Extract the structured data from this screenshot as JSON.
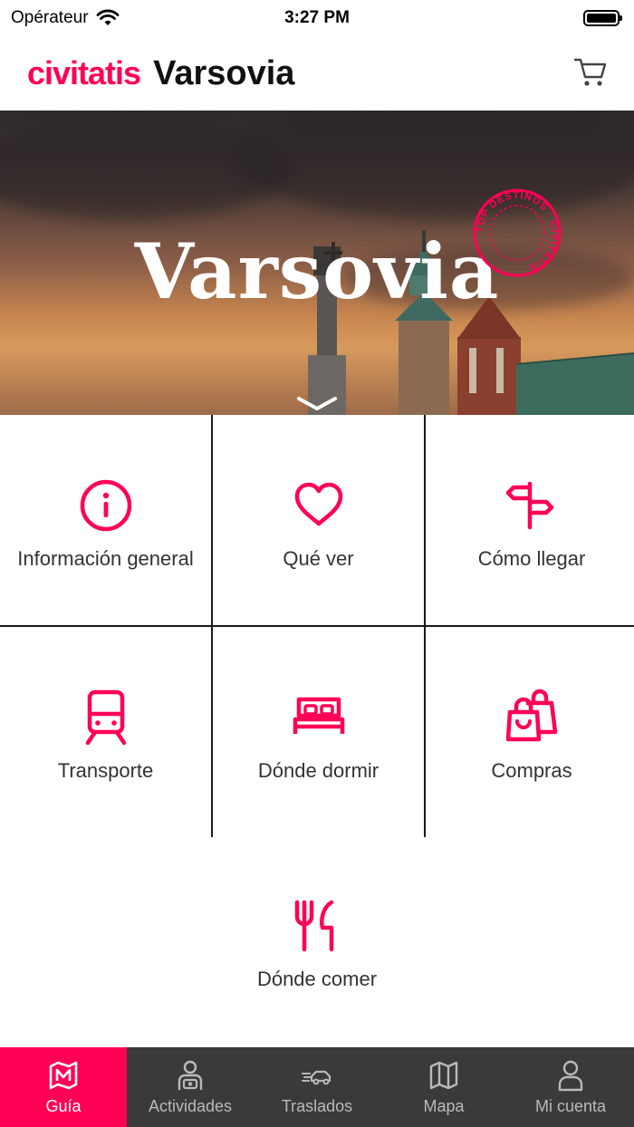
{
  "status": {
    "carrier": "Opérateur",
    "time": "3:27 PM"
  },
  "header": {
    "brand": "civitatis",
    "title": "Varsovia"
  },
  "hero": {
    "title": "Varsovia",
    "stamp_text": "TOP DESTINOS · CIVITATIS"
  },
  "menu": [
    {
      "label": "Información general",
      "icon": "info-icon"
    },
    {
      "label": "Qué ver",
      "icon": "heart-icon"
    },
    {
      "label": "Cómo llegar",
      "icon": "signpost-icon"
    },
    {
      "label": "Transporte",
      "icon": "train-icon"
    },
    {
      "label": "Dónde dormir",
      "icon": "bed-icon"
    },
    {
      "label": "Compras",
      "icon": "shopping-bags-icon"
    },
    {
      "label": "Dónde comer",
      "icon": "cutlery-icon"
    }
  ],
  "tabs": [
    {
      "label": "Guía",
      "icon": "map-guide-icon",
      "active": true
    },
    {
      "label": "Actividades",
      "icon": "activities-icon",
      "active": false
    },
    {
      "label": "Traslados",
      "icon": "transfers-icon",
      "active": false
    },
    {
      "label": "Mapa",
      "icon": "map-icon",
      "active": false
    },
    {
      "label": "Mi cuenta",
      "icon": "account-icon",
      "active": false
    }
  ],
  "colors": {
    "accent": "#ff0055",
    "tab_bar": "#3a3a3a",
    "tab_inactive": "#b9b9b9"
  }
}
